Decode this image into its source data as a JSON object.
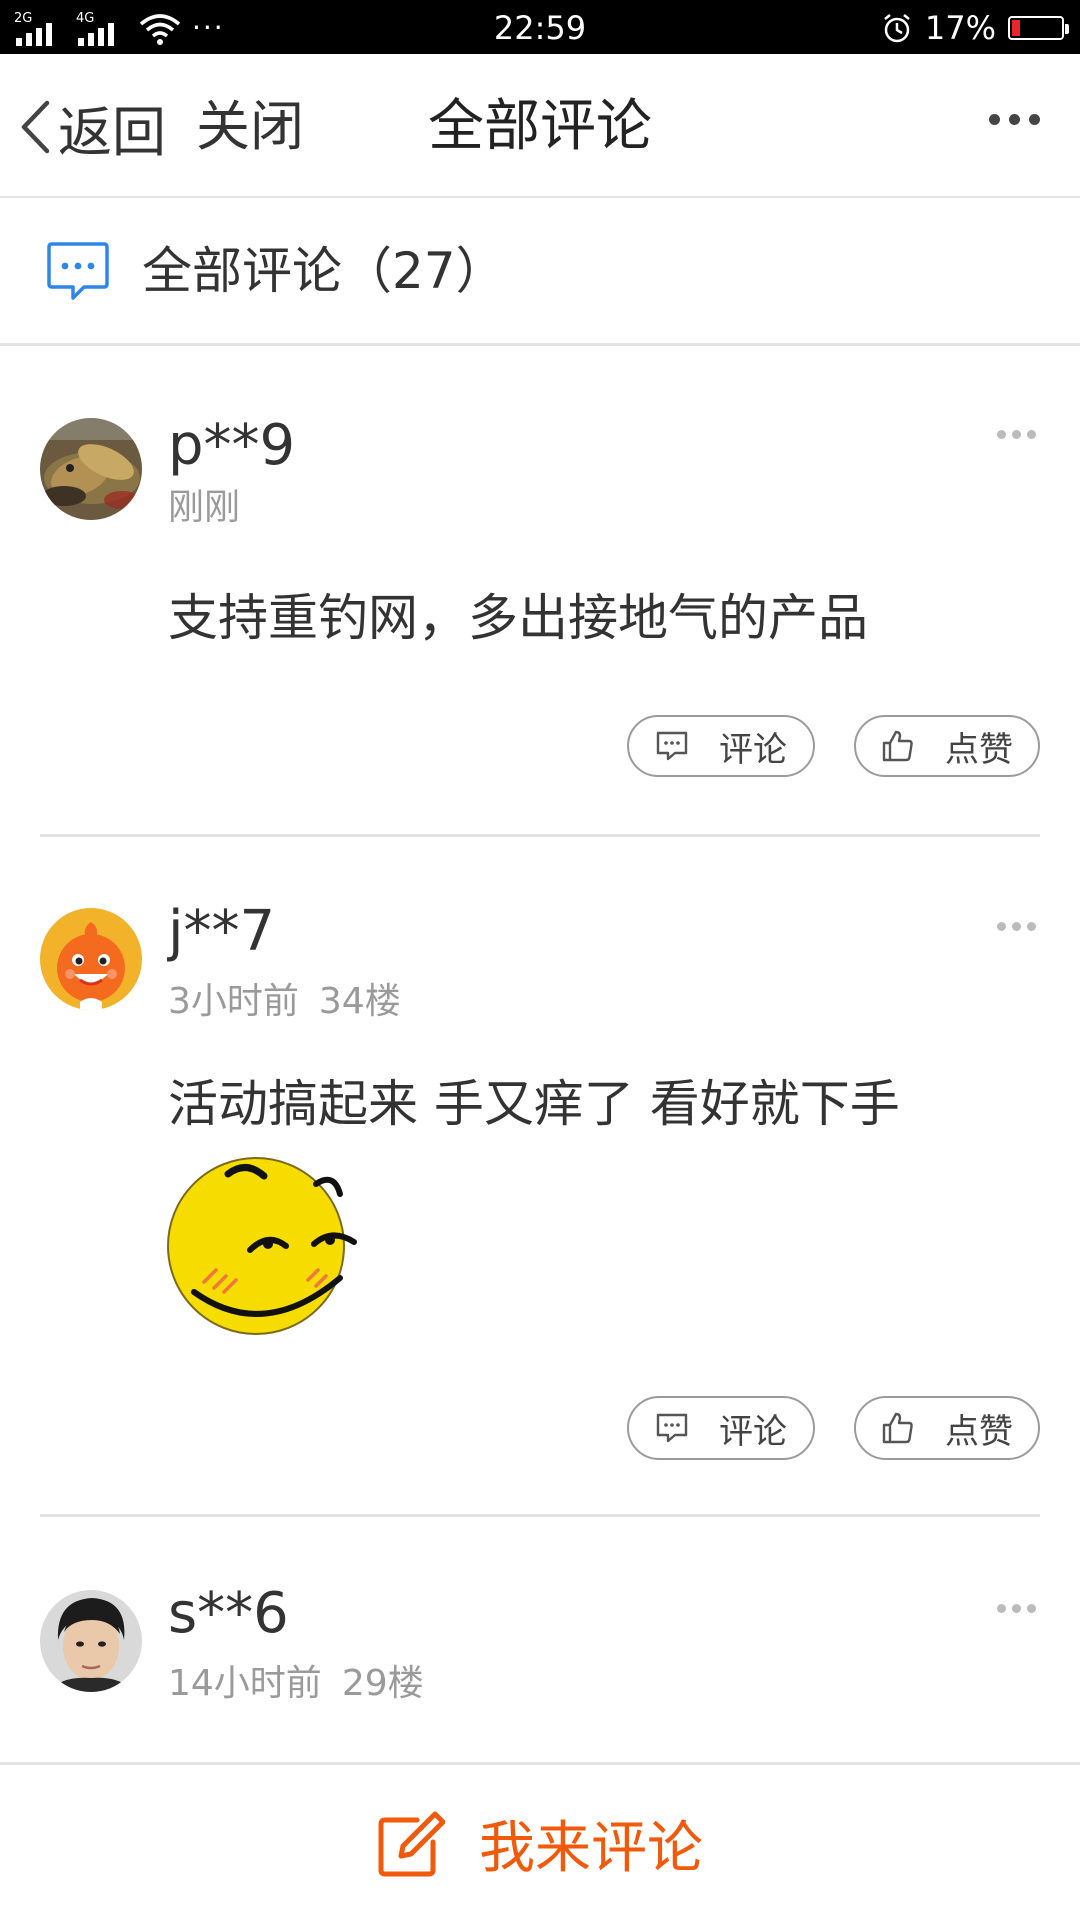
{
  "status_bar": {
    "signal1_label": "2G",
    "signal2_label": "4G",
    "more_indicator": "···",
    "time": "22:59",
    "battery_percent": "17%",
    "battery_level": 0.17,
    "battery_color": "#e8262b",
    "icons": [
      "signal-icon",
      "wifi-icon",
      "alarm-icon",
      "battery-icon"
    ]
  },
  "nav": {
    "back_label": "返回",
    "close_label": "关闭",
    "title": "全部评论",
    "icons": [
      "chevron-left-icon",
      "more-icon"
    ]
  },
  "section": {
    "title": "全部评论（27）",
    "icon": "comment-bubble-icon",
    "accent_color": "#2f86e8"
  },
  "comments": [
    {
      "username": "p**9",
      "time": "刚刚",
      "floor": "",
      "text": "支持重钓网，多出接地气的产品",
      "avatar": "fish-photo",
      "actions": {
        "comment_label": "评论",
        "like_label": "点赞"
      }
    },
    {
      "username": "j**7",
      "time": "3小时前",
      "floor": "34楼",
      "text": "活动搞起来 手又痒了 看好就下手",
      "sticker": "smirk-emoji",
      "avatar": "orange-mascot",
      "actions": {
        "comment_label": "评论",
        "like_label": "点赞"
      }
    },
    {
      "username": "s**6",
      "time": "14小时前",
      "floor": "29楼",
      "avatar": "man-portrait"
    }
  ],
  "bottom": {
    "write_label": "我来评论",
    "icon": "edit-icon",
    "accent_color": "#f25a0b"
  }
}
